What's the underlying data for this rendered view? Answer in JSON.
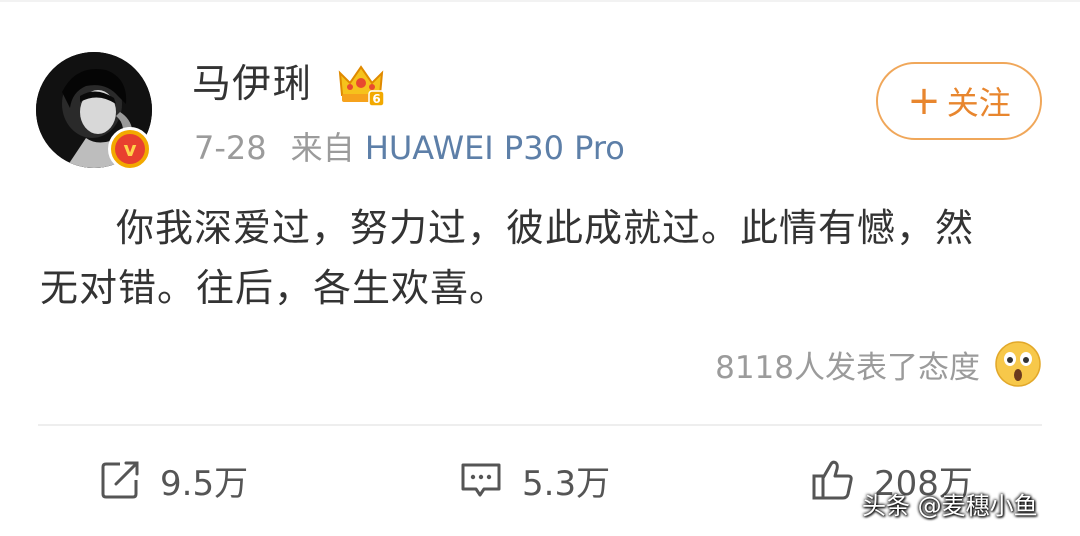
{
  "post": {
    "author_name": "马伊琍",
    "date": "7-28",
    "source_prefix": "来自",
    "source_device": "HUAWEI P30 Pro",
    "follow_label": "关注",
    "body": "你我深爱过，努力过，彼此成就过。此情有憾，然无对错。往后，各生欢喜。",
    "reaction_text": "8118人发表了态度",
    "vip_level": "6",
    "verified_mark": "v"
  },
  "actions": {
    "repost_count": "9.5万",
    "comment_count": "5.3万",
    "like_count": "208万"
  },
  "watermark": "头条 @麦穗小鱼",
  "icons": {
    "avatar": "avatar-photo",
    "verified": "verified-v-icon",
    "vip": "vip-crown-icon",
    "follow": "plus-icon",
    "reaction": "wow-emoji-icon",
    "repost": "repost-icon",
    "comment": "comment-icon",
    "like": "thumbs-up-icon"
  },
  "colors": {
    "follow_accent": "#e8862e",
    "source_link": "#5d7fa8",
    "verified_badge": "#f2a900",
    "muted_text": "#9b9b9b"
  }
}
